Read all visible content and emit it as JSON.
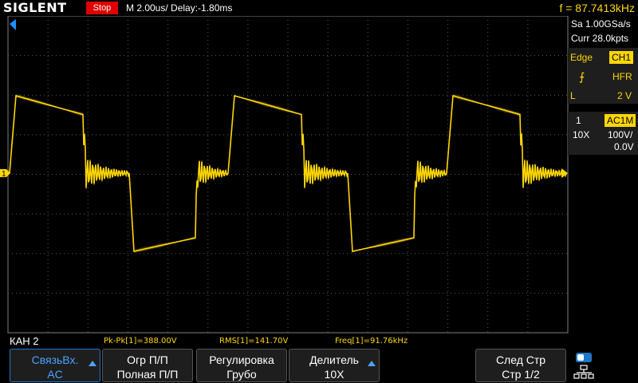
{
  "header": {
    "logo": "SIGLENT",
    "run_state": "Stop",
    "timebase": "M 2.00us/  Delay:-1.80ms",
    "frequency": "f = 87.7413kHz"
  },
  "acquisition": {
    "sample_rate": "Sa 1.00GSa/s",
    "memory": "Curr 28.0kpts"
  },
  "trigger": {
    "type": "Edge",
    "source": "CH1",
    "coupling": "HFR",
    "level_label": "L",
    "level": "2 V"
  },
  "channel": {
    "number": "1",
    "coupling": "AC1M",
    "probe": "10X",
    "scale": "100V/",
    "offset": "0.0V"
  },
  "markers": {
    "ch1_left": "1"
  },
  "measurements": {
    "channel_label": "КАН 2",
    "pkpk": "Pk-Pk[1]=388.00V",
    "rms": "RMS[1]=141.70V",
    "freq": "Freq[1]=91.76kHz"
  },
  "softkeys": [
    {
      "line1": "СвязьВх.",
      "line2": "AC",
      "arrow": true
    },
    {
      "line1": "Огр П/П",
      "line2": "Полная П/П",
      "arrow": false
    },
    {
      "line1": "Регулировка",
      "line2": "Грубо",
      "arrow": false
    },
    {
      "line1": "Делитель",
      "line2": "10X",
      "arrow": true
    },
    {
      "line1": "След Стр",
      "line2": "Стр 1/2",
      "arrow": false
    }
  ],
  "colors": {
    "trace": "#ffd700",
    "grid": "#505050",
    "stop": "#e00000",
    "accent": "#1e78c8"
  }
}
